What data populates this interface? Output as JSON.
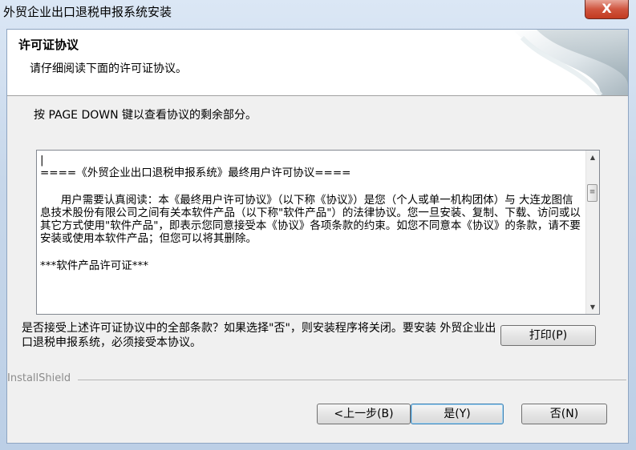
{
  "window": {
    "title": "外贸企业出口退税申报系统安装",
    "close_label": "X"
  },
  "header": {
    "title": "许可证协议",
    "subtitle": "请仔细阅读下面的许可证协议。"
  },
  "instruction": "按 PAGE DOWN 键以查看协议的剩余部分。",
  "license": {
    "line1": "|",
    "heading": "====《外贸企业出口退税申报系统》最终用户许可协议====",
    "paragraph": "      用户需要认真阅读：本《最终用户许可协议》（以下称《协议》）是您（个人或单一机构团体）与 大连龙图信息技术股份有限公司之间有关本软件产品（以下称\"软件产品\"）的法律协议。您一旦安装、复制、下载、访问或以其它方式使用\"软件产品\"，即表示您同意接受本《协议》各项条款的约束。如您不同意本《协议》的条款，请不要安装或使用本软件产品；但您可以将其删除。",
    "section": "***软件产品许可证***"
  },
  "question": "是否接受上述许可证协议中的全部条款？如果选择\"否\"，则安装程序将关闭。要安装 外贸企业出口退税申报系统，必须接受本协议。",
  "footer": {
    "brand": "InstallShield"
  },
  "buttons": {
    "print": "打印(P)",
    "back": "<上一步(B)",
    "yes": "是(Y)",
    "no": "否(N)"
  },
  "scroll": {
    "up_icon": "▲",
    "down_icon": "▼",
    "thumb_icon": "≡"
  }
}
